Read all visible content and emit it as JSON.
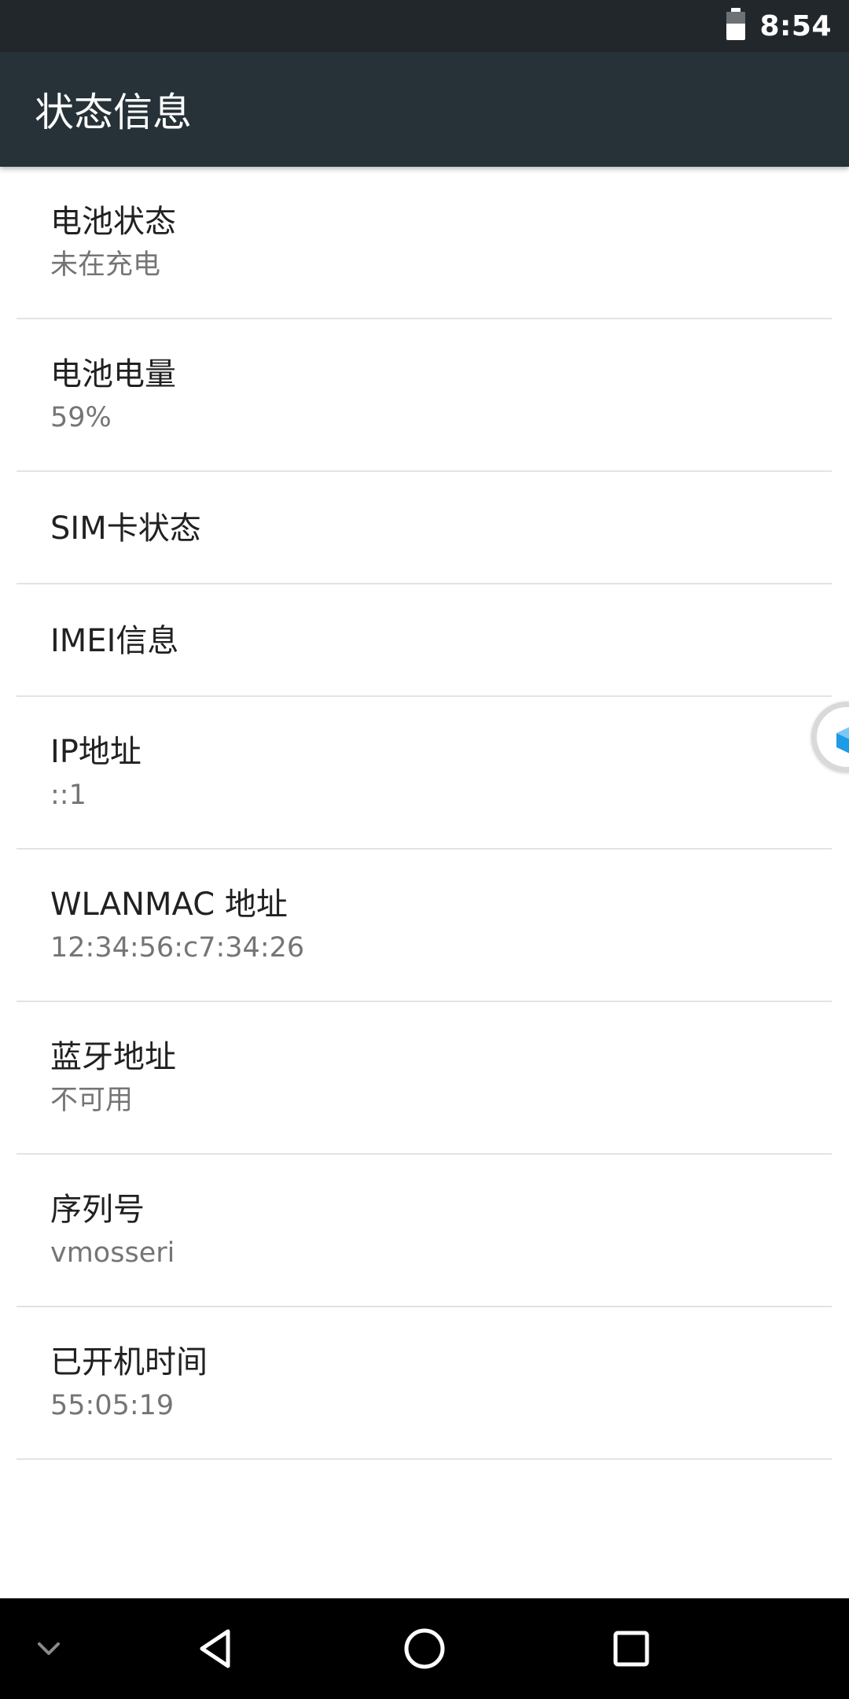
{
  "status_bar": {
    "time": "8:54",
    "battery_icon": "battery-icon",
    "battery_level": 0.59
  },
  "toolbar": {
    "title": "状态信息"
  },
  "items": [
    {
      "title": "电池状态",
      "value": "未在充电"
    },
    {
      "title": "电池电量",
      "value": "59%"
    },
    {
      "title": "SIM卡状态",
      "value": ""
    },
    {
      "title": "IMEI信息",
      "value": ""
    },
    {
      "title": "IP地址",
      "value": "::1"
    },
    {
      "title": "WLANMAC 地址",
      "value": "12:34:56:c7:34:26"
    },
    {
      "title": "蓝牙地址",
      "value": "不可用"
    },
    {
      "title": "序列号",
      "value": "vmosseri"
    },
    {
      "title": "已开机时间",
      "value": "55:05:19"
    }
  ],
  "floating_bubble": {
    "icon": "cube-icon"
  },
  "nav_bar": {
    "icons": [
      "chevron-down-icon",
      "back-icon",
      "home-icon",
      "recents-icon"
    ]
  },
  "colors": {
    "status_bar": "#21272b",
    "toolbar": "#263238",
    "title_text": "#212121",
    "secondary_text": "#757575",
    "divider": "#e3e3e3",
    "accent_cube": "#1e9be6"
  }
}
